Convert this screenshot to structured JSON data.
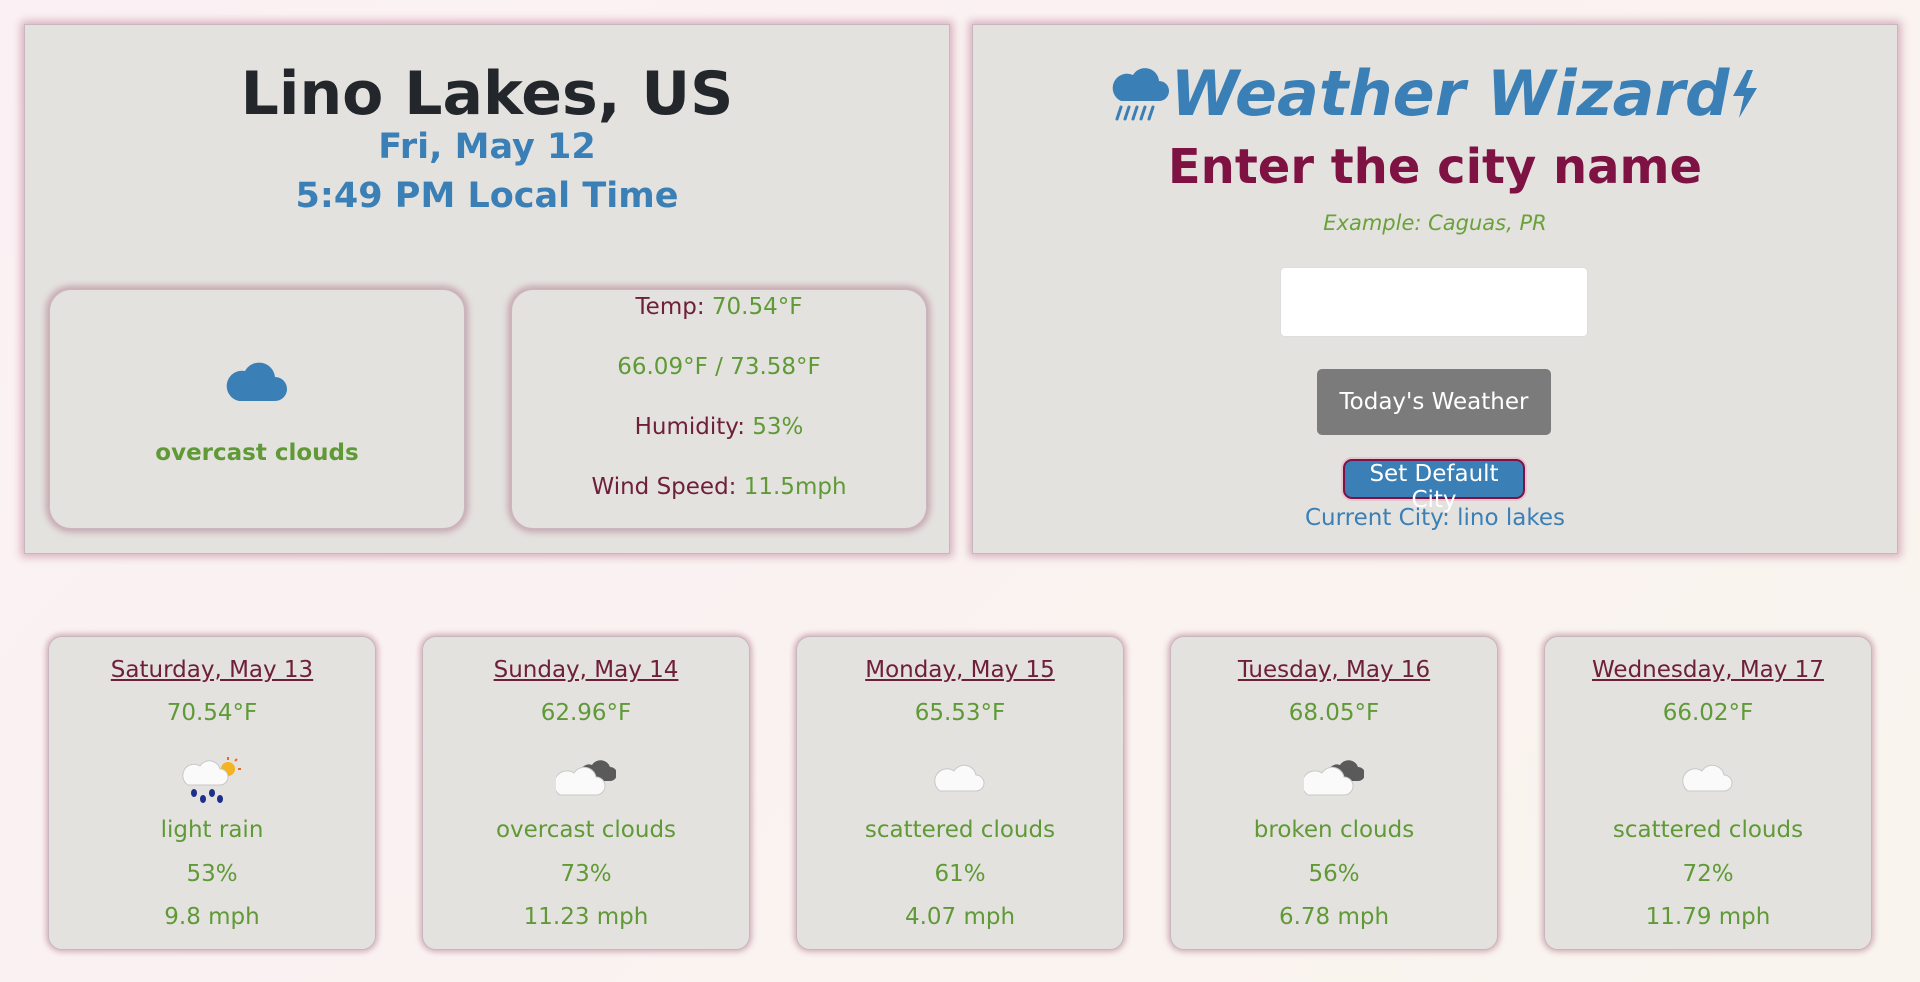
{
  "current": {
    "city": "Lino Lakes, US",
    "date": "Fri, May 12",
    "time": "5:49 PM Local Time",
    "condition_icon": "cloud-icon",
    "condition": "overcast clouds",
    "temp_label": "Temp: ",
    "temp_value": "70.54°F",
    "range": "66.09°F / 73.58°F",
    "humidity_label": "Humidity: ",
    "humidity_value": "53%",
    "wind_label": "Wind Speed: ",
    "wind_value": "11.5mph"
  },
  "search": {
    "brand": "Weather Wizard",
    "brand_icons": [
      "cloud-rain-icon",
      "lightning-icon"
    ],
    "title": "Enter the city name",
    "example": "Example: Caguas, PR",
    "input_value": "",
    "todays_weather_label": "Today's Weather",
    "set_default_label": "Set Default City",
    "current_city": "Current City: lino lakes"
  },
  "forecast": [
    {
      "date": "Saturday, May 13",
      "temp": "70.54°F",
      "icon": "light-rain-icon",
      "desc": "light rain",
      "humidity": "53%",
      "wind": "9.8 mph"
    },
    {
      "date": "Sunday, May 14",
      "temp": "62.96°F",
      "icon": "overcast-clouds-icon",
      "desc": "overcast clouds",
      "humidity": "73%",
      "wind": "11.23 mph"
    },
    {
      "date": "Monday, May 15",
      "temp": "65.53°F",
      "icon": "scattered-clouds-icon",
      "desc": "scattered clouds",
      "humidity": "61%",
      "wind": "4.07 mph"
    },
    {
      "date": "Tuesday, May 16",
      "temp": "68.05°F",
      "icon": "broken-clouds-icon",
      "desc": "broken clouds",
      "humidity": "56%",
      "wind": "6.78 mph"
    },
    {
      "date": "Wednesday, May 17",
      "temp": "66.02°F",
      "icon": "scattered-clouds-icon",
      "desc": "scattered clouds",
      "humidity": "72%",
      "wind": "11.79 mph"
    }
  ],
  "colors": {
    "accent_blue": "#3a7fb5",
    "green_value": "#5f9a36",
    "maroon_label": "#6e2038",
    "title_maroon": "#7e1243",
    "panel_bg": "#e4e2df"
  }
}
